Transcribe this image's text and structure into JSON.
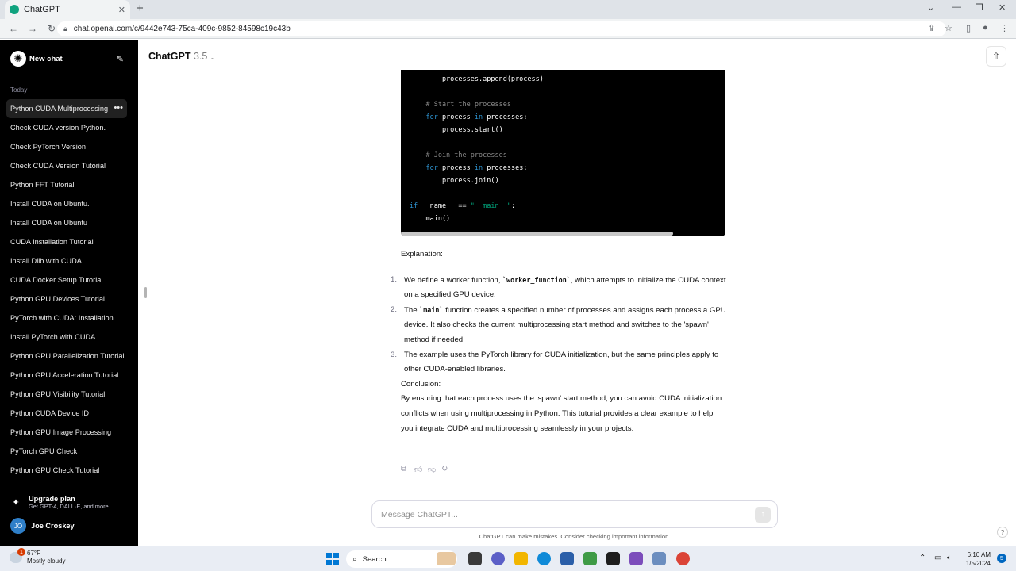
{
  "browser": {
    "tab_title": "ChatGPT",
    "url": "chat.openai.com/c/9442e743-75ca-409c-9852-84598c19c43b"
  },
  "sidebar": {
    "new_chat": "New chat",
    "section_label": "Today",
    "items": [
      {
        "label": "Python CUDA Multiprocessing"
      },
      {
        "label": "Check CUDA version Python."
      },
      {
        "label": "Check PyTorch Version"
      },
      {
        "label": "Check CUDA Version Tutorial"
      },
      {
        "label": "Python FFT Tutorial"
      },
      {
        "label": "Install CUDA on Ubuntu."
      },
      {
        "label": "Install CUDA on Ubuntu"
      },
      {
        "label": "CUDA Installation Tutorial"
      },
      {
        "label": "Install Dlib with CUDA"
      },
      {
        "label": "CUDA Docker Setup Tutorial"
      },
      {
        "label": "Python GPU Devices Tutorial"
      },
      {
        "label": "PyTorch with CUDA: Installation"
      },
      {
        "label": "Install PyTorch with CUDA"
      },
      {
        "label": "Python GPU Parallelization Tutorial"
      },
      {
        "label": "Python GPU Acceleration Tutorial"
      },
      {
        "label": "Python GPU Visibility Tutorial"
      },
      {
        "label": "Python CUDA Device ID"
      },
      {
        "label": "Python GPU Image Processing"
      },
      {
        "label": "PyTorch GPU Check"
      },
      {
        "label": "Python GPU Check Tutorial"
      }
    ],
    "upgrade_title": "Upgrade plan",
    "upgrade_sub": "Get GPT-4, DALL·E, and more",
    "user_initials": "JO",
    "user_name": "Joe Croskey"
  },
  "header": {
    "model_name": "ChatGPT",
    "model_version": "3.5"
  },
  "code": {
    "lines": [
      "        processes.append(process)",
      "",
      "    # Start the processes",
      "    for process in processes:",
      "        process.start()",
      "",
      "    # Join the processes",
      "    for process in processes:",
      "        process.join()",
      "",
      "if __name__ == \"__main__\":",
      "    main()"
    ]
  },
  "answer": {
    "explanation_heading": "Explanation:",
    "item1_num": "1.",
    "item1_a": "We define a worker function, ",
    "item1_code": "`worker_function`",
    "item1_b": ", which attempts to initialize the CUDA context on a specified GPU device.",
    "item2_num": "2.",
    "item2_a": "The ",
    "item2_code": "`main`",
    "item2_b": " function creates a specified number of processes and assigns each process a GPU device. It also checks the current multiprocessing start method and switches to the 'spawn' method if needed.",
    "item3_num": "3.",
    "item3_text": "The example uses the PyTorch library for CUDA initialization, but the same principles apply to other CUDA-enabled libraries.",
    "conclusion_heading": "Conclusion:",
    "conclusion_text": "By ensuring that each process uses the 'spawn' start method, you can avoid CUDA initialization conflicts when using multiprocessing in Python. This tutorial provides a clear example to help you integrate CUDA and multiprocessing seamlessly in your projects."
  },
  "composer": {
    "placeholder": "Message ChatGPT...",
    "disclaimer": "ChatGPT can make mistakes. Consider checking important information."
  },
  "taskbar": {
    "weather_badge": "1",
    "temperature": "67°F",
    "condition": "Mostly cloudy",
    "search_label": "Search",
    "time": "6:10 AM",
    "date": "1/5/2024",
    "notification_count": "5"
  },
  "colors": {
    "sidebar_bg": "#000000",
    "code_keyword": "#2e95d3",
    "code_string": "#00a67d",
    "brand": "#10a37f"
  }
}
